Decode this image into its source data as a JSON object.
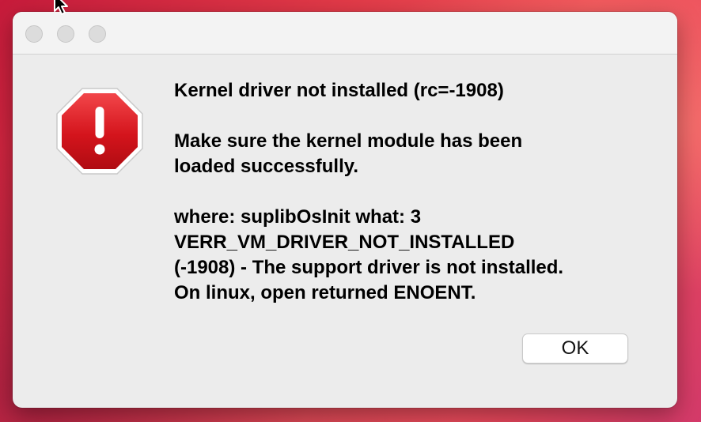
{
  "dialog": {
    "title_message": "Kernel driver not installed (rc=-1908)",
    "detail_message": "Make sure the kernel module has been\nloaded successfully.",
    "error_details": "where: suplibOsInit what: 3\nVERR_VM_DRIVER_NOT_INSTALLED\n(-1908) - The support driver is not installed.\nOn linux, open returned ENOENT.",
    "ok_label": "OK",
    "icon": "stop-error-icon"
  },
  "titlebar": {
    "buttons": [
      "close",
      "minimize",
      "zoom"
    ]
  },
  "colors": {
    "icon_red": "#d4141c",
    "dialog_bg": "#ececec",
    "desktop_accent": "#e23a48"
  }
}
